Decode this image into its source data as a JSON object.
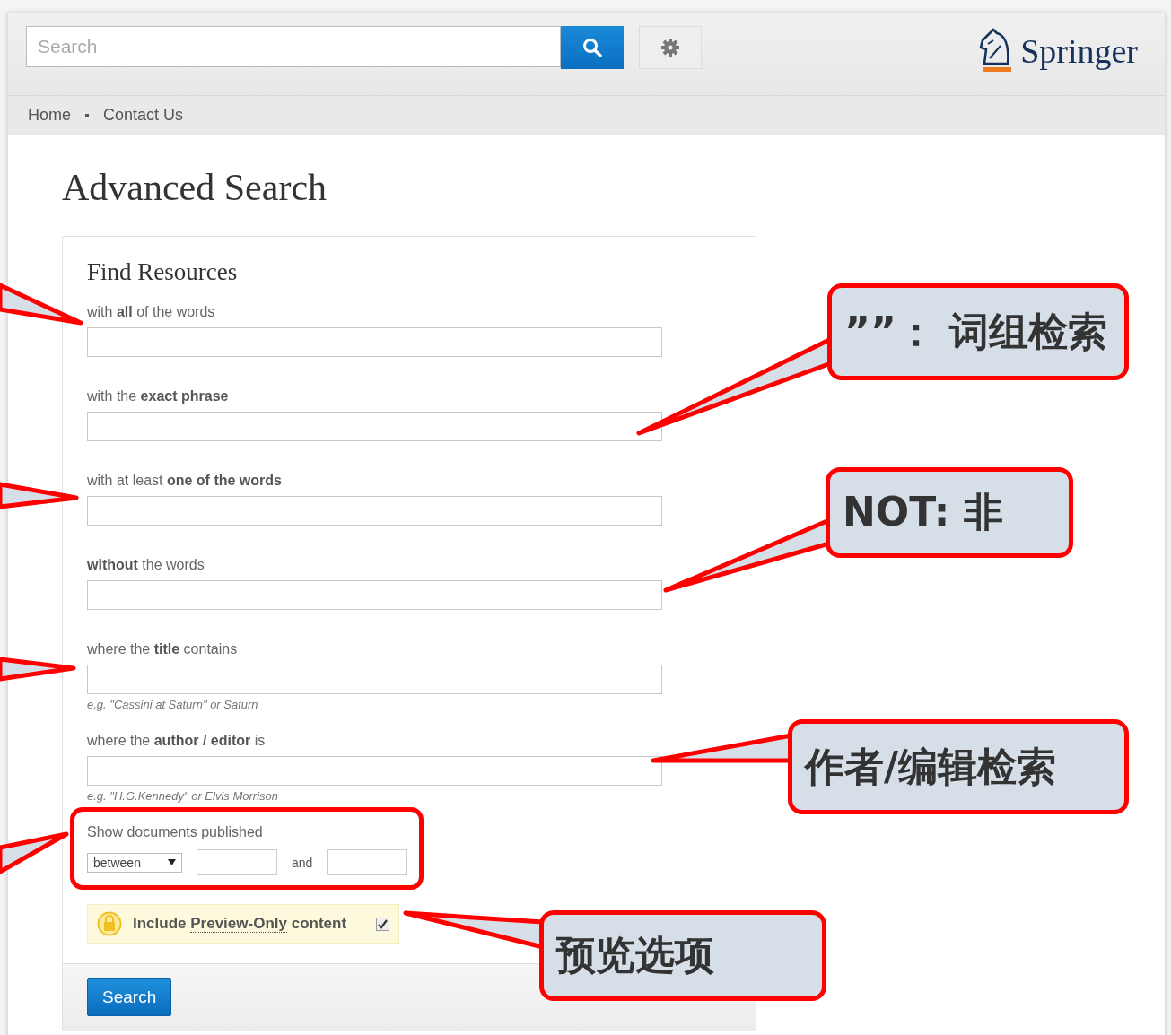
{
  "header": {
    "search": {
      "placeholder": "Search"
    },
    "logo": {
      "text": "Springer"
    }
  },
  "breadcrumb": [
    "Home",
    "Contact Us"
  ],
  "page_title": "Advanced Search",
  "form": {
    "title": "Find Resources",
    "fields": [
      {
        "label": "with **all** of the words"
      },
      {
        "label": "with the **exact phrase**"
      },
      {
        "label": "with at least **one of the words**"
      },
      {
        "label": "**without** the words"
      },
      {
        "label": "where the **title** contains",
        "hint": "e.g. \"Cassini at Saturn\" or Saturn"
      },
      {
        "label": "where the **author / editor** is",
        "hint": "e.g. \"H.G.Kennedy\" or Elvis Morrison"
      }
    ],
    "date": {
      "label": "Show documents published",
      "mode": "between",
      "joiner": "and"
    },
    "preview": {
      "text_before": "Include",
      "link": "Preview-Only",
      "text_after": "content",
      "checked": true
    },
    "submit": "Search"
  },
  "annotations": [
    {
      "text": "””： 词组检索"
    },
    {
      "text": "NOT: 非"
    },
    {
      "text": "作者/编辑检索"
    },
    {
      "text": "预览选项"
    }
  ]
}
